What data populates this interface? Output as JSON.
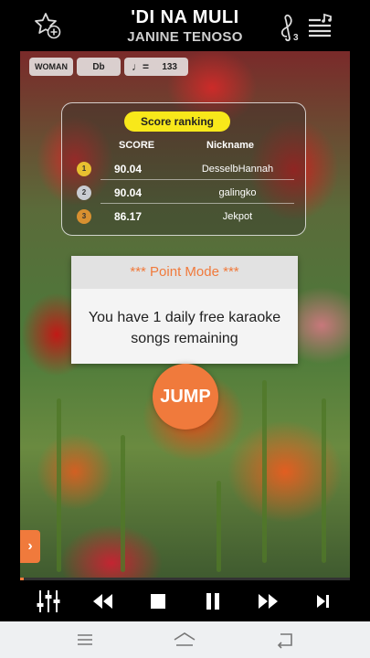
{
  "header": {
    "song_title": "'DI NA MULI",
    "artist": "JANINE TENOSO",
    "favorite_icon": "star-plus-icon",
    "key_icon": "treble-clef-icon",
    "menu_icon": "list-music-icon"
  },
  "info_strip": {
    "voice": "WOMAN",
    "key": "Db",
    "tempo_symbol": "♩=",
    "tempo": "133"
  },
  "ranking": {
    "title": "Score ranking",
    "score_header": "SCORE",
    "nickname_header": "Nickname",
    "rows": [
      {
        "rank": "1",
        "score": "90.04",
        "nickname": "DesselbHannah"
      },
      {
        "rank": "2",
        "score": "90.04",
        "nickname": "galingko"
      },
      {
        "rank": "3",
        "score": "86.17",
        "nickname": "Jekpot"
      }
    ],
    "medal_colors": [
      "#e8c030",
      "#c9ccd2",
      "#d89030"
    ]
  },
  "dialog": {
    "title": "*** Point Mode ***",
    "message": "You have 1 daily free karaoke songs remaining"
  },
  "jump_label": "JUMP",
  "side_arrow": "›",
  "playback": {
    "progress_percent": 1
  },
  "controls": [
    "mixer-icon",
    "rewind-icon",
    "stop-icon",
    "pause-icon",
    "fast-forward-icon",
    "skip-next-icon"
  ],
  "navbar": [
    "recent-apps-icon",
    "home-icon",
    "back-icon"
  ],
  "colors": {
    "accent": "#f07a3c",
    "rank_badge": "#f8e81a"
  }
}
